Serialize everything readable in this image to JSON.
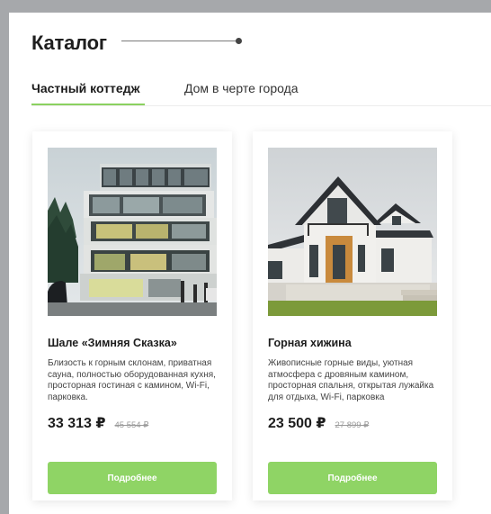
{
  "catalog": {
    "title": "Каталог"
  },
  "tabs": [
    {
      "label": "Частный коттедж",
      "active": true
    },
    {
      "label": "Дом в черте города",
      "active": false
    }
  ],
  "cards": [
    {
      "title": "Шале «Зимняя Сказка»",
      "description": "Близость к горным склонам, приватная сауна, полностью оборудованная кухня, просторная гостиная с камином, Wi-Fi, парковка.",
      "price": "33 313 ₽",
      "old_price": "45 554 ₽",
      "button": "Подробнее",
      "image": "modern-glass-villa-photo"
    },
    {
      "title": "Горная хижина",
      "description": "Живописные горные виды, уютная атмосфера с дровяным камином, просторная спальня, открытая лужайка для отдыха, Wi-Fi, парковка",
      "price": "23 500 ₽",
      "old_price": "27 899 ₽",
      "button": "Подробнее",
      "image": "gabled-cottage-photo"
    }
  ],
  "colors": {
    "accent": "#8fd465",
    "frame": "#a6a8ab"
  }
}
